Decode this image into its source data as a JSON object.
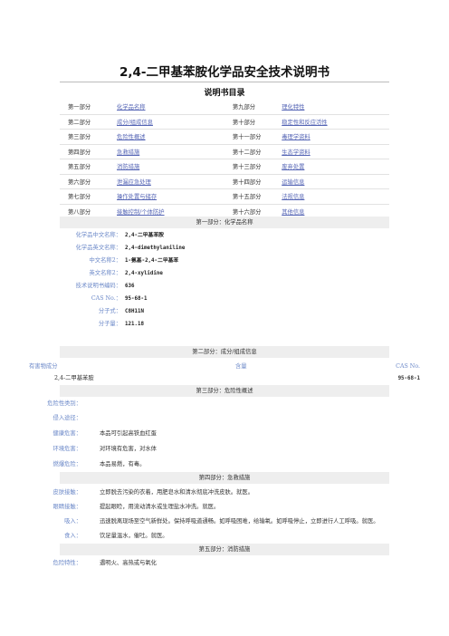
{
  "title": "2,4-二甲基苯胺化学品安全技术说明书",
  "toc_heading": "说明书目录",
  "toc": [
    [
      "第一部分",
      "化学品名称",
      "第九部分",
      "理化特性"
    ],
    [
      "第二部分",
      "成分/组成信息",
      "第十部分",
      "稳定性和反应活性"
    ],
    [
      "第三部分",
      "危险性概述",
      "第十一部分",
      "毒理学资料"
    ],
    [
      "第四部分",
      "急救措施",
      "第十二部分",
      "生态学资料"
    ],
    [
      "第五部分",
      "消防措施",
      "第十三部分",
      "废弃处置"
    ],
    [
      "第六部分",
      "泄漏应急处理",
      "第十四部分",
      "运输信息"
    ],
    [
      "第七部分",
      "操作处置与储存",
      "第十五部分",
      "法规信息"
    ],
    [
      "第八部分",
      "接触控制/个体防护",
      "第十六部分",
      "其他信息"
    ]
  ],
  "sec1": {
    "heading": "第一部分：化学品名称",
    "rows": [
      {
        "label": "化学品中文名称：",
        "value": "2,4-二甲基苯胺"
      },
      {
        "label": "化学品英文名称：",
        "value": "2,4-dimethylaniline"
      },
      {
        "label": "中文名称2：",
        "value": "1-氨基-2,4-二甲基苯"
      },
      {
        "label": "英文名称2：",
        "value": "2,4-xylidine"
      },
      {
        "label": "技术说明书编码：",
        "value": "636"
      },
      {
        "label": "CAS No.：",
        "value": "95-68-1"
      },
      {
        "label": "分子式：",
        "value": "C8H11N"
      },
      {
        "label": "分子量：",
        "value": "121.18"
      }
    ]
  },
  "sec2": {
    "heading": "第二部分：成分/组成信息",
    "col_substance": "有害物成分",
    "col_content": "含量",
    "col_cas": "CAS No.",
    "substance": "2,4-二甲基苯胺",
    "content": "",
    "cas": "95-68-1"
  },
  "sec3": {
    "heading": "第三部分：危险性概述",
    "rows": [
      {
        "label": "危险性类别：",
        "text": ""
      },
      {
        "label": "侵入途径：",
        "text": ""
      },
      {
        "label": "健康危害：",
        "text": "本品可引起高铁血红蛋"
      },
      {
        "label": "环境危害：",
        "text": "对环境有危害，对水体"
      },
      {
        "label": "燃爆危险：",
        "text": "本品易燃，有毒。"
      }
    ]
  },
  "sec4": {
    "heading": "第四部分：急救措施",
    "rows": [
      {
        "label": "皮肤接触：",
        "text": "立即脱去污染的衣着，用肥皂水和清水彻底冲洗皮肤。就医。"
      },
      {
        "label": "眼睛接触：",
        "text": "提起眼睑，用流动清水或生理盐水冲洗。就医。"
      },
      {
        "label": "吸入：",
        "text": "迅速脱离现场至空气新鲜处。保持呼吸道通畅。如呼吸困难，给输氧。如呼吸停止，立即进行人工呼吸。就医。"
      },
      {
        "label": "食入：",
        "text": "饮足量温水，催吐。就医。"
      }
    ]
  },
  "sec5": {
    "heading": "第五部分：消防措施",
    "rows": [
      {
        "label": "危险特性：",
        "text": "遇明火、高热或与氧化"
      }
    ]
  }
}
